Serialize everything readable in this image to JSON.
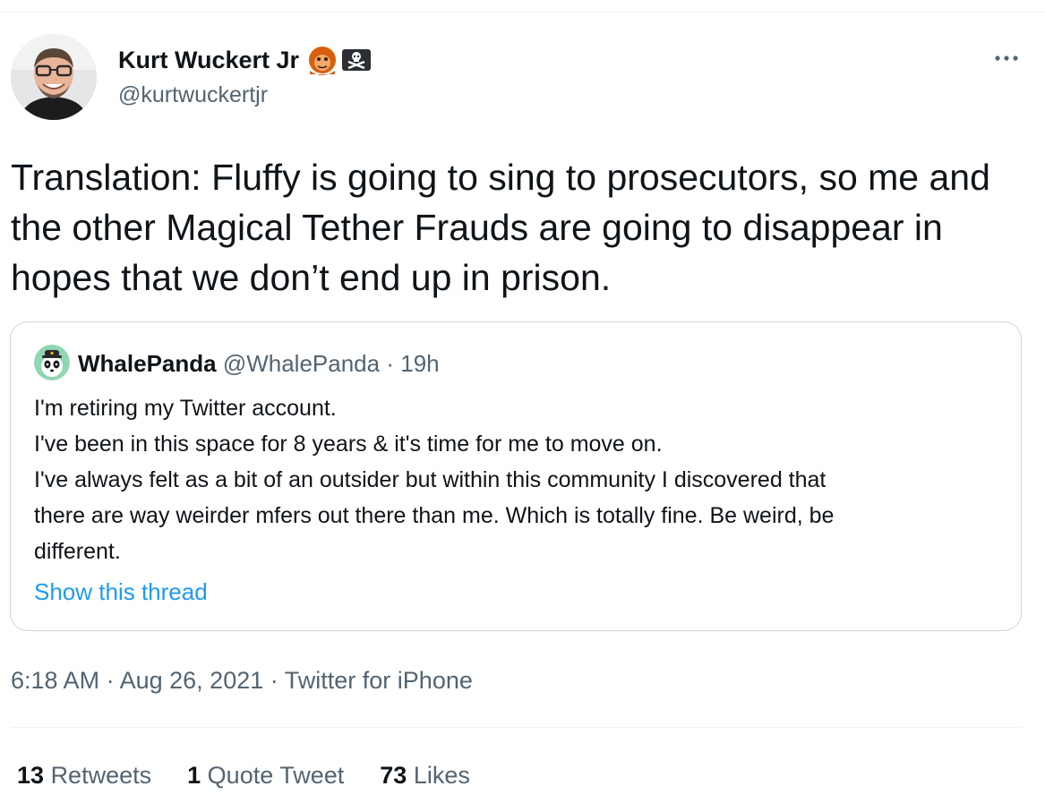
{
  "author": {
    "display_name": "Kurt Wuckert Jr",
    "handle": "@kurtwuckertjr",
    "badges": [
      "orangutan-emoji-icon",
      "pirate-flag-emoji-icon"
    ]
  },
  "tweet": {
    "text": "Translation: Fluffy is going to sing to prosecutors, so me and the other Magical Tether Frauds are going to disappear in hopes that we don’t end up in prison."
  },
  "quote": {
    "name": "WhalePanda",
    "handle": "@WhalePanda",
    "separator": "·",
    "time": "19h",
    "lines": [
      "I'm retiring my Twitter account.",
      "I've been in this space for 8 years & it's time for me to move on.",
      "I've always felt as a bit of an outsider but within this community I discovered that",
      "there are way weirder mfers out there than me. Which is totally fine. Be weird, be",
      "different."
    ],
    "show_thread_label": "Show this thread"
  },
  "meta": {
    "time": "6:18 AM",
    "separator": "·",
    "date": "Aug 26, 2021",
    "source": "Twitter for iPhone"
  },
  "stats": {
    "retweets": {
      "count": "13",
      "label": "Retweets"
    },
    "quotes": {
      "count": "1",
      "label": "Quote Tweet"
    },
    "likes": {
      "count": "73",
      "label": "Likes"
    }
  },
  "colors": {
    "text_primary": "#0f1419",
    "text_secondary": "#536471",
    "link": "#1d9bf0",
    "border": "#cfd9de",
    "divider": "#eff3f4"
  },
  "icons": {
    "more": "more-dots-icon"
  }
}
